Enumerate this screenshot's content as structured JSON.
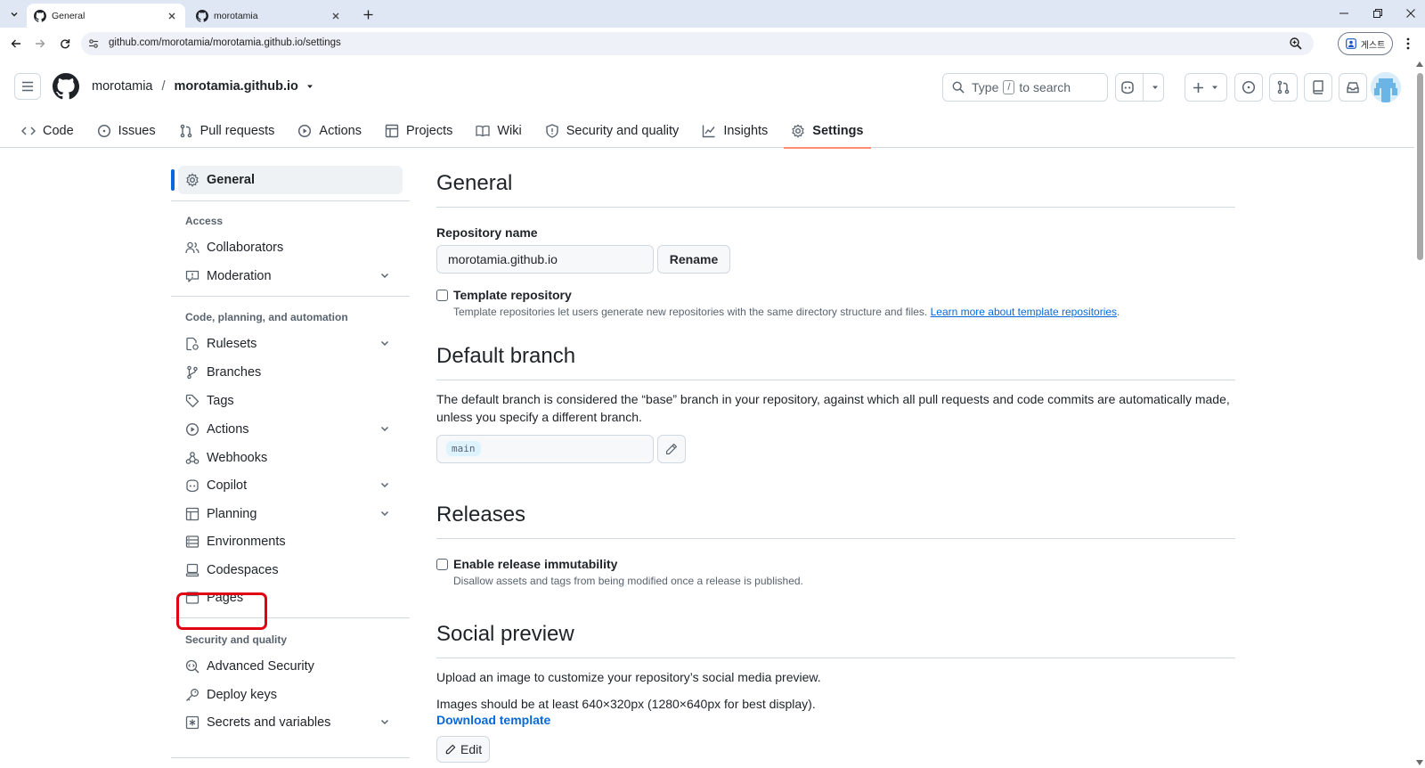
{
  "browser": {
    "tabs": [
      {
        "title": "General",
        "active": true
      },
      {
        "title": "morotamia",
        "active": false
      }
    ],
    "url": "github.com/morotamia/morotamia.github.io/settings",
    "profile_label": "게스트"
  },
  "header": {
    "owner": "morotamia",
    "separator": "/",
    "repo": "morotamia.github.io",
    "search": {
      "prefix": "Type",
      "key": "/",
      "suffix": "to search"
    }
  },
  "repo_nav": [
    {
      "label": "Code",
      "icon": "code-icon"
    },
    {
      "label": "Issues",
      "icon": "issue-icon"
    },
    {
      "label": "Pull requests",
      "icon": "pull-request-icon"
    },
    {
      "label": "Actions",
      "icon": "play-icon"
    },
    {
      "label": "Projects",
      "icon": "table-icon"
    },
    {
      "label": "Wiki",
      "icon": "book-icon"
    },
    {
      "label": "Security and quality",
      "icon": "shield-icon"
    },
    {
      "label": "Insights",
      "icon": "graph-icon"
    },
    {
      "label": "Settings",
      "icon": "gear-icon",
      "selected": true
    }
  ],
  "sidebar": {
    "general": "General",
    "headings": {
      "access": "Access",
      "code": "Code, planning, and automation",
      "security": "Security and quality"
    },
    "items": {
      "collaborators": "Collaborators",
      "moderation": "Moderation",
      "rulesets": "Rulesets",
      "branches": "Branches",
      "tags": "Tags",
      "actions": "Actions",
      "webhooks": "Webhooks",
      "copilot": "Copilot",
      "planning": "Planning",
      "environments": "Environments",
      "codespaces": "Codespaces",
      "pages": "Pages",
      "advanced_security": "Advanced Security",
      "deploy_keys": "Deploy keys",
      "secrets": "Secrets and variables"
    }
  },
  "main": {
    "general_title": "General",
    "repo_name_label": "Repository name",
    "repo_name_value": "morotamia.github.io",
    "rename_button": "Rename",
    "template_label": "Template repository",
    "template_note": "Template repositories let users generate new repositories with the same directory structure and files.",
    "template_link": "Learn more about template repositories",
    "default_branch_title": "Default branch",
    "default_branch_text_1": "The default branch is considered the “base” branch in your repository, against which all pull requests and code commits are automatically made,",
    "default_branch_text_2": "unless you specify a different branch.",
    "default_branch_value": "main",
    "releases_title": "Releases",
    "immutability_label": "Enable release immutability",
    "immutability_note": "Disallow assets and tags from being modified once a release is published.",
    "social_title": "Social preview",
    "social_text_1": "Upload an image to customize your repository’s social media preview.",
    "social_text_2": "Images should be at least 640×320px (1280×640px for best display).",
    "download_template": "Download template",
    "edit_button": "Edit"
  },
  "colors": {
    "accent": "#0969da",
    "selected_underline": "#fd8c73",
    "highlight": "#e00012"
  }
}
